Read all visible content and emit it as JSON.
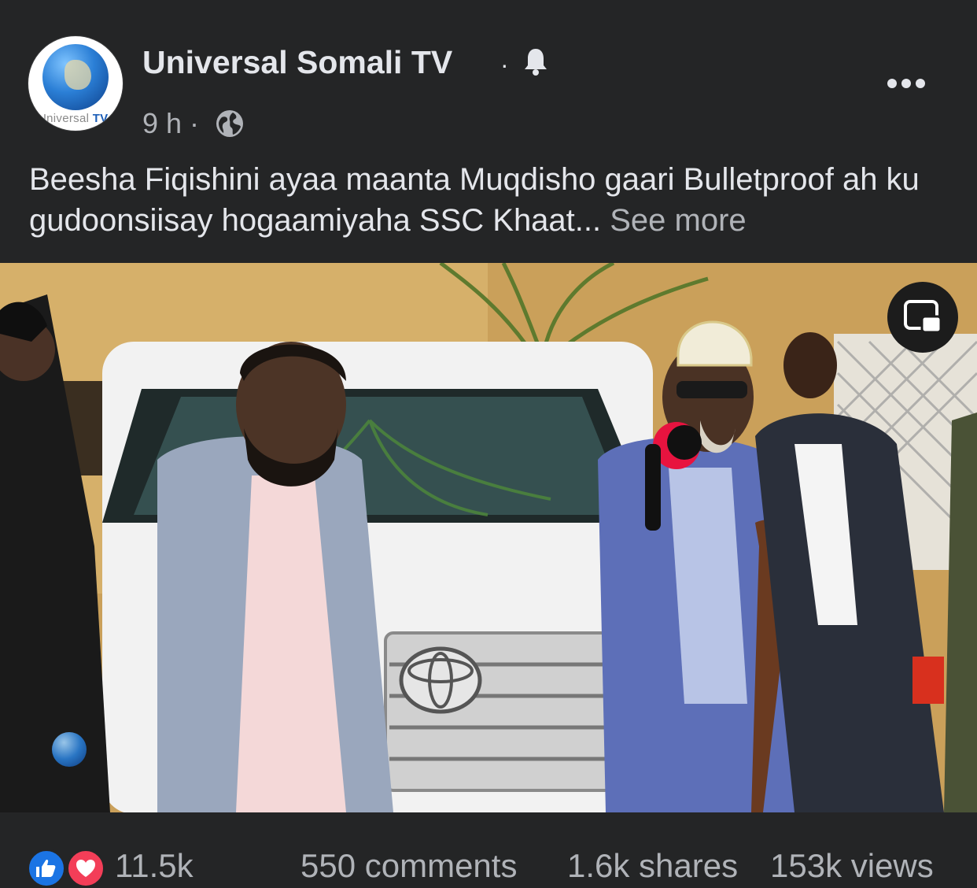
{
  "post": {
    "page_name": "Universal Somali TV",
    "separator": "·",
    "time": "9 h ·",
    "avatar_brand_prefix": "Universal ",
    "avatar_brand_suffix": "TV",
    "caption": "Beesha Fiqishini ayaa maanta Muqdisho gaari Bulletproof ah ku gudoonsiisay hogaamiyaha SSC Khaat...",
    "see_more": " See more",
    "icons": {
      "notification": "bell-icon",
      "more": "more-options-icon",
      "audience": "globe-icon",
      "pip": "picture-in-picture-icon"
    }
  },
  "reactions": {
    "count": "11.5k",
    "icons": [
      "like-icon",
      "love-icon"
    ]
  },
  "stats": {
    "comments": "550 comments",
    "shares": "1.6k shares",
    "views": "153k views"
  },
  "colors": {
    "background": "#242526",
    "text_primary": "#e4e6eb",
    "text_secondary": "#b0b3b8",
    "like_blue": "#1b74e4",
    "love_red": "#f33e58"
  }
}
